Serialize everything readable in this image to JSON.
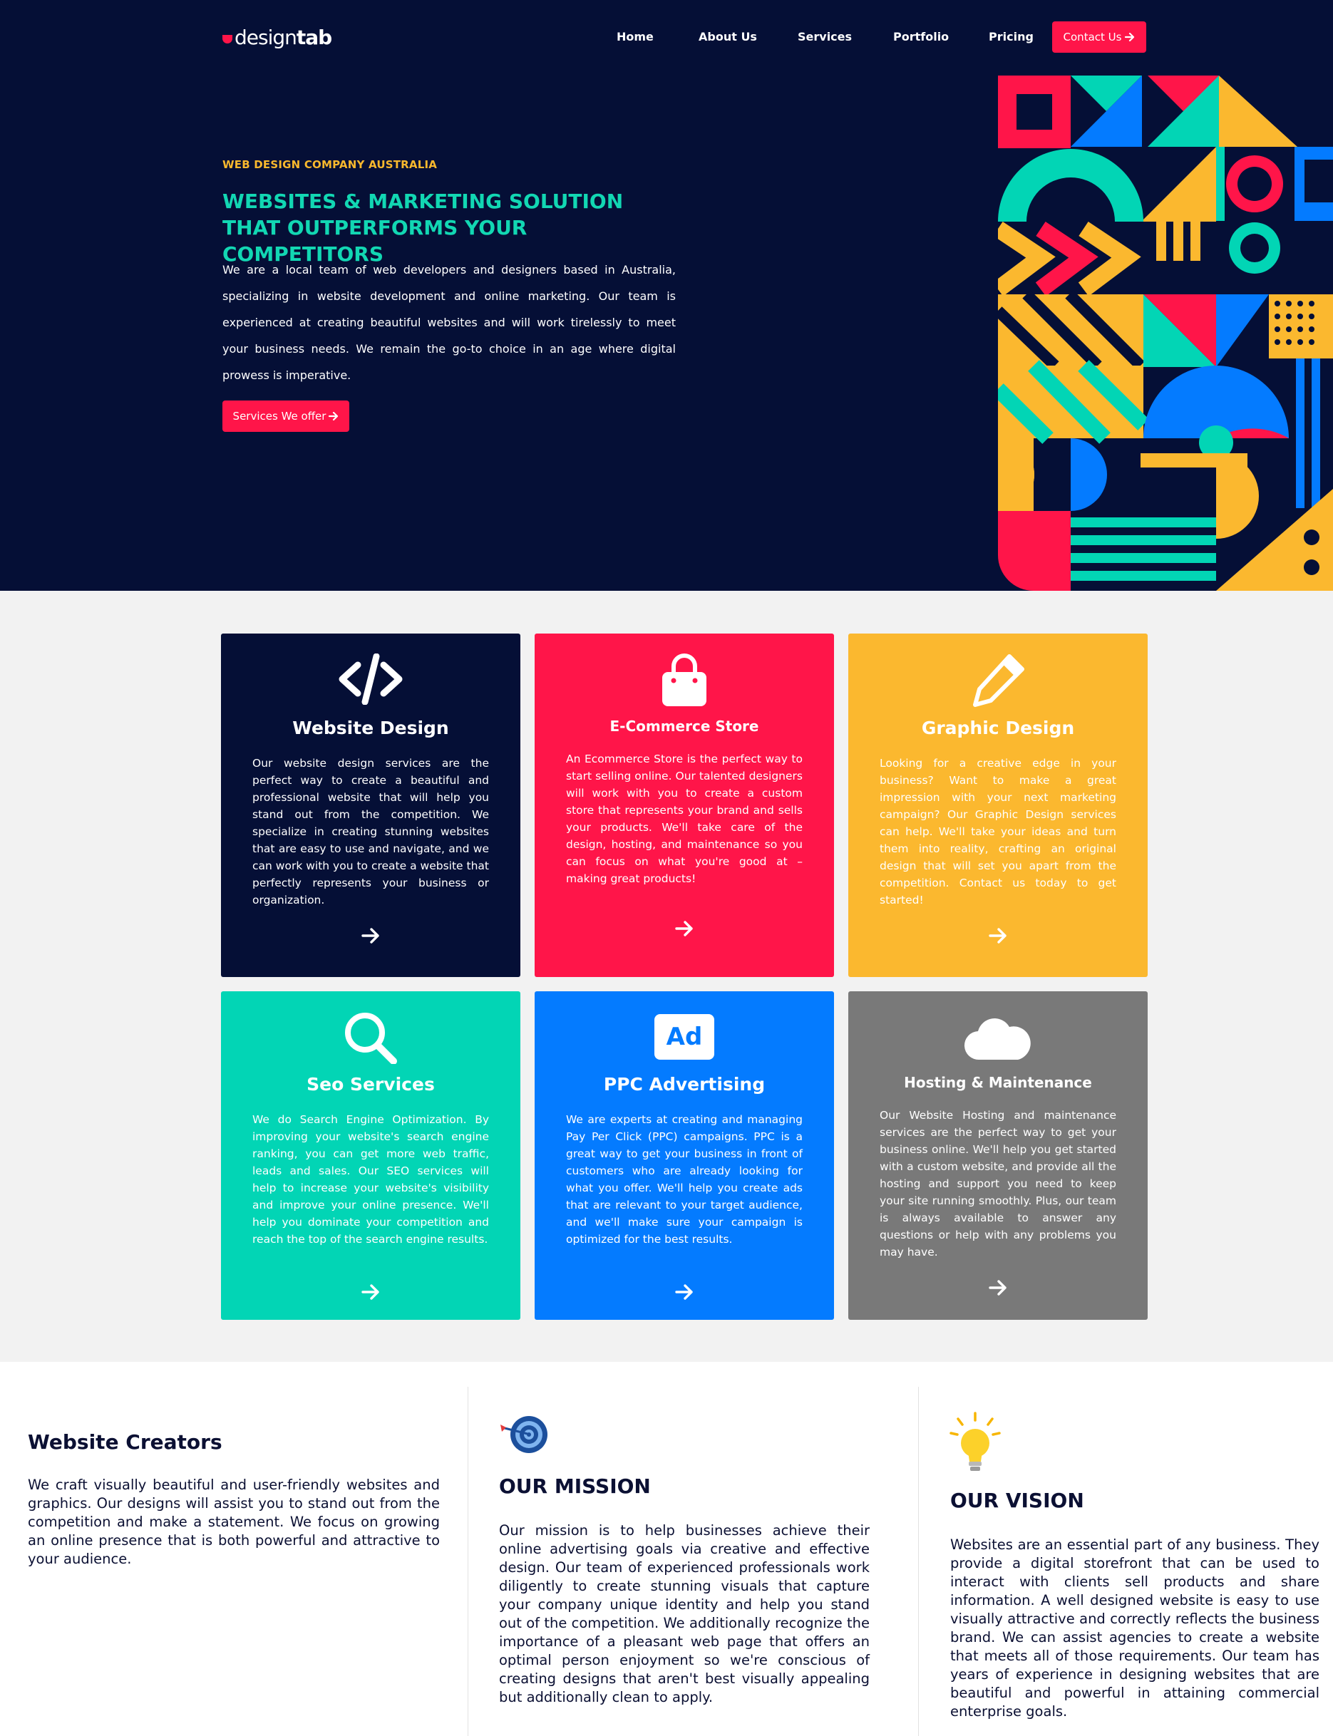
{
  "brand": {
    "logo_light": "design",
    "logo_bold": "tab"
  },
  "nav": {
    "items": [
      "Home",
      "About Us",
      "Services",
      "Portfolio",
      "Pricing"
    ],
    "contact_label": "Contact Us"
  },
  "hero": {
    "eyebrow": "WEB DESIGN COMPANY AUSTRALIA",
    "title": "WEBSITES & MARKETING SOLUTION THAT OUTPERFORMS YOUR COMPETITORS",
    "description": "We are a local team of web developers and designers based in Australia, specializing in website development and online marketing. Our team is experienced at creating beautiful websites and will work tirelessly to meet your business needs. We remain the go-to choice in an age where digital prowess is imperative.",
    "button_label": "Services We offer"
  },
  "services": [
    {
      "title": "Website Design",
      "icon": "code-icon",
      "color": "#050f36",
      "text": "Our website design services are the perfect way to create a beautiful and professional website that will help you stand out from the competition. We specialize in creating stunning websites that are easy to use and navigate, and we can work with you to create a website that perfectly represents your business or organization."
    },
    {
      "title": "E-Commerce Store",
      "icon": "shopping-bag-icon",
      "color": "#ff1549",
      "text": "An Ecommerce Store is the perfect way to start selling online. Our talented designers will work with you to create a custom store that represents your brand and sells your products. We'll take care of the design, hosting, and maintenance so you can focus on what you're good at – making great products!"
    },
    {
      "title": "Graphic Design",
      "icon": "pencil-icon",
      "color": "#fbb82f",
      "text": "Looking for a creative edge in your business? Want to make a great impression with your next marketing campaign? Our Graphic Design services can help. We'll take your ideas and turn them into reality, crafting an original design that will set you apart from the competition. Contact us today to get started!"
    },
    {
      "title": "Seo Services",
      "icon": "search-icon",
      "color": "#02d5b5",
      "text": "We do Search Engine Optimization. By improving your website's search engine ranking, you can get more web traffic, leads and sales. Our SEO services will help to increase your website's visibility and improve your online presence. We'll help you dominate your competition and reach the top of the search engine results."
    },
    {
      "title": "PPC Advertising",
      "icon": "ad-icon",
      "icon_text": "Ad",
      "color": "#047bff",
      "text": "We are experts at creating and managing Pay Per Click (PPC) campaigns. PPC is a great way to get your business in front of customers who are already looking for what you offer. We'll help you create ads that are relevant to your target audience, and we'll make sure your campaign is optimized for the best results."
    },
    {
      "title": "Hosting & Maintenance",
      "icon": "cloud-icon",
      "color": "#797979",
      "text": "Our Website Hosting and maintenance services are the perfect way to get your business online. We'll help you get started with a custom website, and provide all the hosting and support you need to keep your site running smoothly. Plus, our team is always available to answer any questions or help with any problems you may have."
    }
  ],
  "about": {
    "creators_title": "Website Creators",
    "creators_text": "We craft visually beautiful and user-friendly websites and graphics. Our designs will assist you to stand out from the competition and make a statement. We focus on growing an online presence that is both powerful and attractive to your audience.",
    "mission_title": "OUR MISSION",
    "mission_text": "Our mission is to help businesses achieve their online advertising goals via creative and effective design. Our team of experienced professionals work diligently to create stunning visuals that capture your company unique identity and help you stand out of the competition. We additionally recognize the importance of a pleasant web page that offers an optimal person enjoyment so we're conscious of creating designs that aren't best visually appealing but additionally clean to apply.",
    "vision_title": "OUR VISION",
    "vision_text": "Websites are an essential part of any business. They provide a digital storefront that can be used to interact with clients sell products and share information. A well designed website is easy to use visually attractive and correctly reflects the business brand. We can assist agencies to create a website that meets all of those requirements. Our team has years of experience in designing websites that are beautiful and powerful in attaining commercial enterprise goals."
  },
  "colors": {
    "navy": "#050f36",
    "red": "#ff1549",
    "teal": "#12d7b3",
    "yellow": "#f9b82d",
    "blue": "#047bff",
    "grey": "#797979"
  }
}
